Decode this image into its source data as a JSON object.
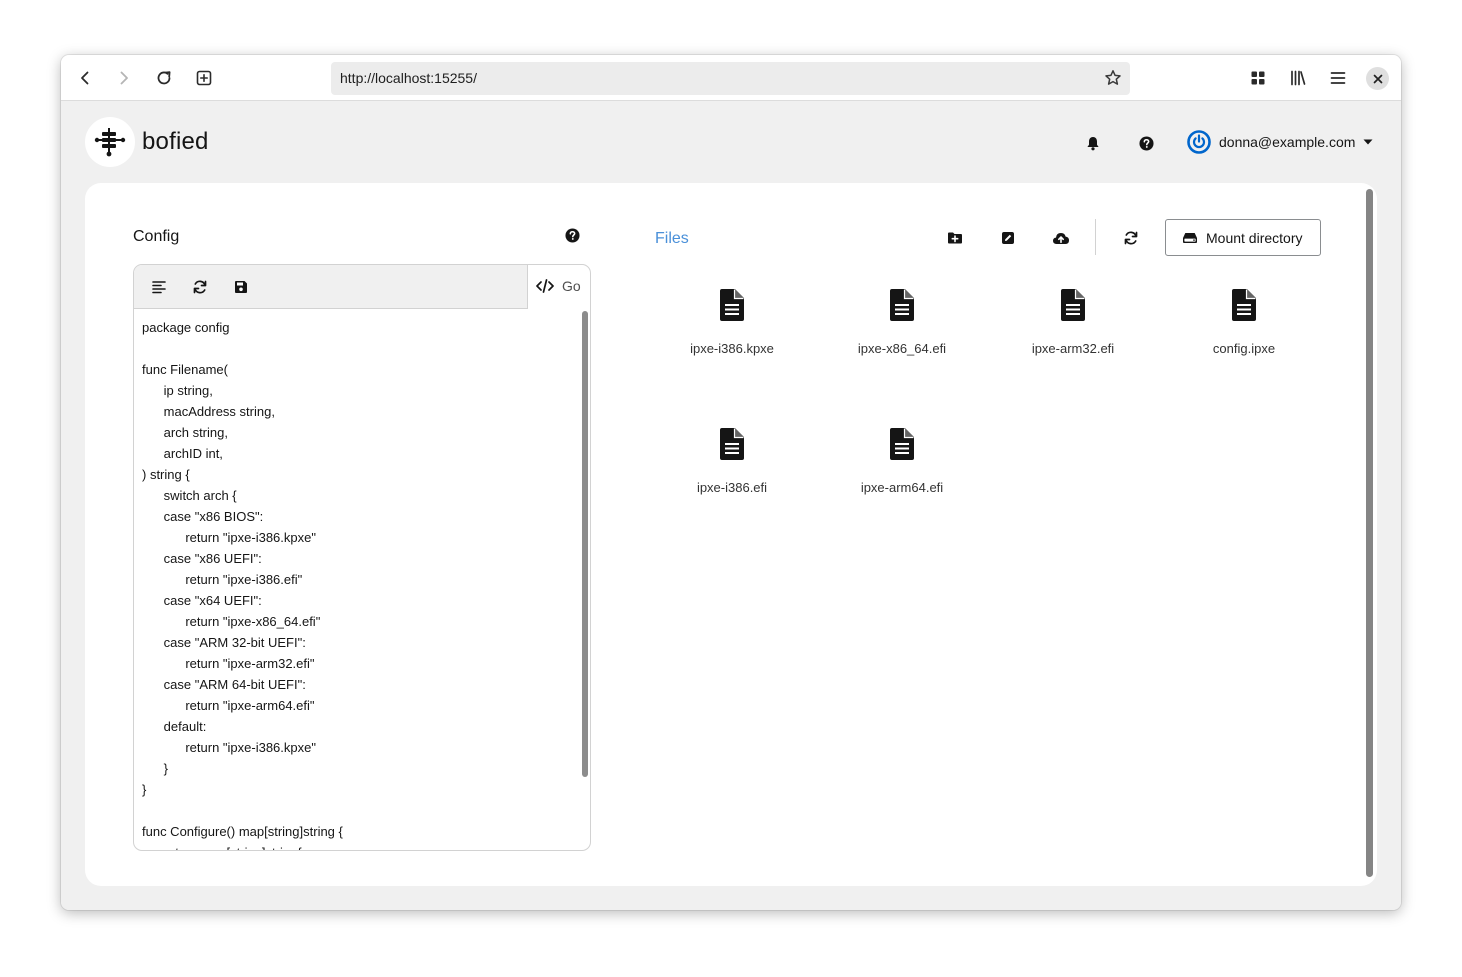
{
  "browser": {
    "url": "http://localhost:15255/"
  },
  "app": {
    "name": "bofied",
    "user_email": "donna@example.com"
  },
  "config": {
    "title": "Config",
    "language": "Go",
    "code_lines": [
      "package config",
      "",
      "func Filename(",
      "      ip string,",
      "      macAddress string,",
      "      arch string,",
      "      archID int,",
      ") string {",
      "      switch arch {",
      "      case \"x86 BIOS\":",
      "            return \"ipxe-i386.kpxe\"",
      "      case \"x86 UEFI\":",
      "            return \"ipxe-i386.efi\"",
      "      case \"x64 UEFI\":",
      "            return \"ipxe-x86_64.efi\"",
      "      case \"ARM 32-bit UEFI\":",
      "            return \"ipxe-arm32.efi\"",
      "      case \"ARM 64-bit UEFI\":",
      "            return \"ipxe-arm64.efi\"",
      "      default:",
      "            return \"ipxe-i386.kpxe\"",
      "      }",
      "}",
      "",
      "func Configure() map[string]string {",
      "      return map[string]string{"
    ]
  },
  "files": {
    "title": "Files",
    "mount_label": "Mount directory",
    "items": [
      {
        "name": "ipxe-i386.kpxe"
      },
      {
        "name": "ipxe-x86_64.efi"
      },
      {
        "name": "ipxe-arm32.efi"
      },
      {
        "name": "config.ipxe"
      },
      {
        "name": "ipxe-i386.efi"
      },
      {
        "name": "ipxe-arm64.efi"
      }
    ]
  },
  "colors": {
    "accent": "#4a90d9",
    "avatar": "#0066cc"
  },
  "icons": {
    "back": "arrow-left-icon",
    "forward": "arrow-right-icon",
    "reload": "reload-icon",
    "new_tab": "plus-square-icon",
    "bookmark": "star-icon",
    "extensions": "grid-icon",
    "library": "library-icon",
    "menu": "hamburger-icon",
    "close": "close-icon",
    "notifications": "bell-icon",
    "help": "question-circle-icon",
    "file": "file-text-icon",
    "create_folder": "folder-plus-icon",
    "rename": "edit-icon",
    "upload": "cloud-upload-icon",
    "refresh": "sync-icon",
    "format": "align-left-icon",
    "save": "save-icon",
    "mount": "hdd-icon",
    "code": "code-icon"
  }
}
